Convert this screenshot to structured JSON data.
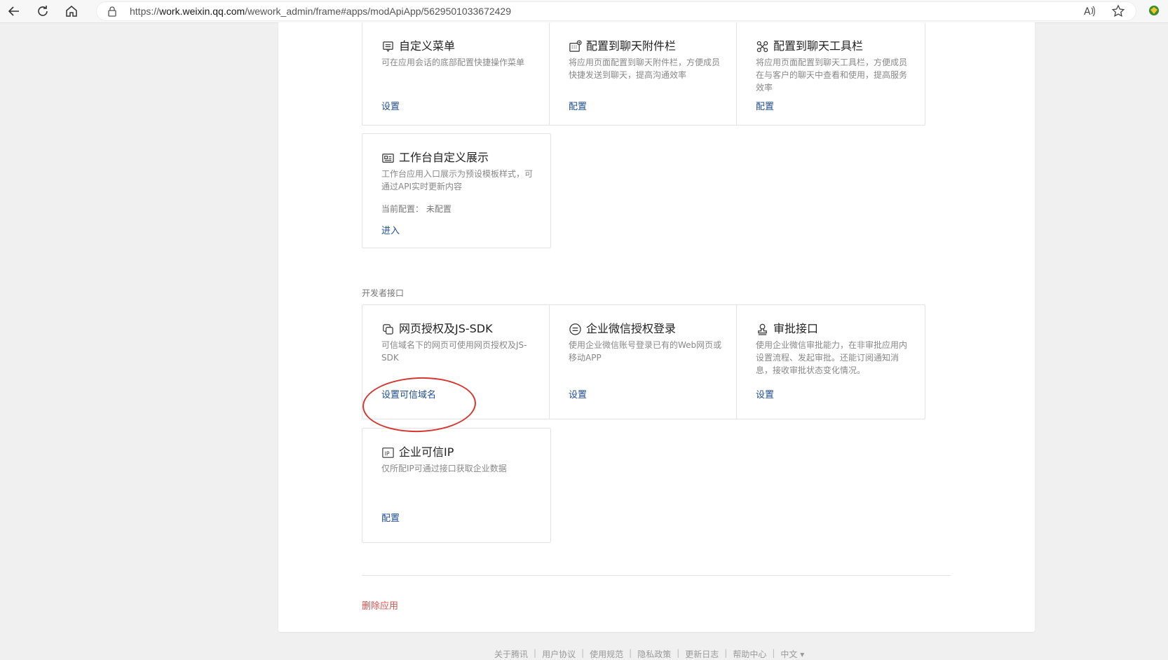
{
  "browser": {
    "url_prefix": "https://",
    "url_host": "work.weixin.qq.com",
    "url_path": "/wework_admin/frame#apps/modApiApp/5629501033672429"
  },
  "cards_top": [
    {
      "title": "自定义菜单",
      "desc": "可在应用会话的底部配置快捷操作菜单",
      "link": "设置",
      "icon": "menu-icon"
    },
    {
      "title": "配置到聊天附件栏",
      "desc": "将应用页面配置到聊天附件栏，方便成员快捷发送到聊天，提高沟通效率",
      "link": "配置",
      "icon": "attachment-bar-icon"
    },
    {
      "title": "配置到聊天工具栏",
      "desc": "将应用页面配置到聊天工具栏，方便成员在与客户的聊天中查看和使用，提高服务效率",
      "link": "配置",
      "icon": "toolbar-icon"
    },
    {
      "title": "工作台自定义展示",
      "desc": "工作台应用入口展示为预设模板样式，可通过API实时更新内容",
      "status": "当前配置： 未配置",
      "link": "进入",
      "icon": "workbench-icon"
    }
  ],
  "dev_section_label": "开发者接口",
  "cards_dev": [
    {
      "title": "网页授权及JS-SDK",
      "desc": "可信域名下的网页可使用网页授权及JS-SDK",
      "link": "设置可信域名",
      "icon": "web-auth-icon"
    },
    {
      "title": "企业微信授权登录",
      "desc": "使用企业微信账号登录已有的Web网页或移动APP",
      "link": "设置",
      "icon": "login-icon"
    },
    {
      "title": "审批接口",
      "desc": "使用企业微信审批能力，在非审批应用内设置流程、发起审批。还能订阅通知消息，接收审批状态变化情况。",
      "link": "设置",
      "icon": "approval-icon"
    },
    {
      "title": "企业可信IP",
      "desc": "仅所配IP可通过接口获取企业数据",
      "link": "配置",
      "icon": "ip-icon"
    }
  ],
  "delete_label": "删除应用",
  "footer": [
    "关于腾讯",
    "用户协议",
    "使用规范",
    "隐私政策",
    "更新日志",
    "帮助中心",
    "中文 ▾"
  ],
  "colors": {
    "link": "#1f4e8c",
    "danger": "#d9534f",
    "highlight": "#d4372f"
  }
}
